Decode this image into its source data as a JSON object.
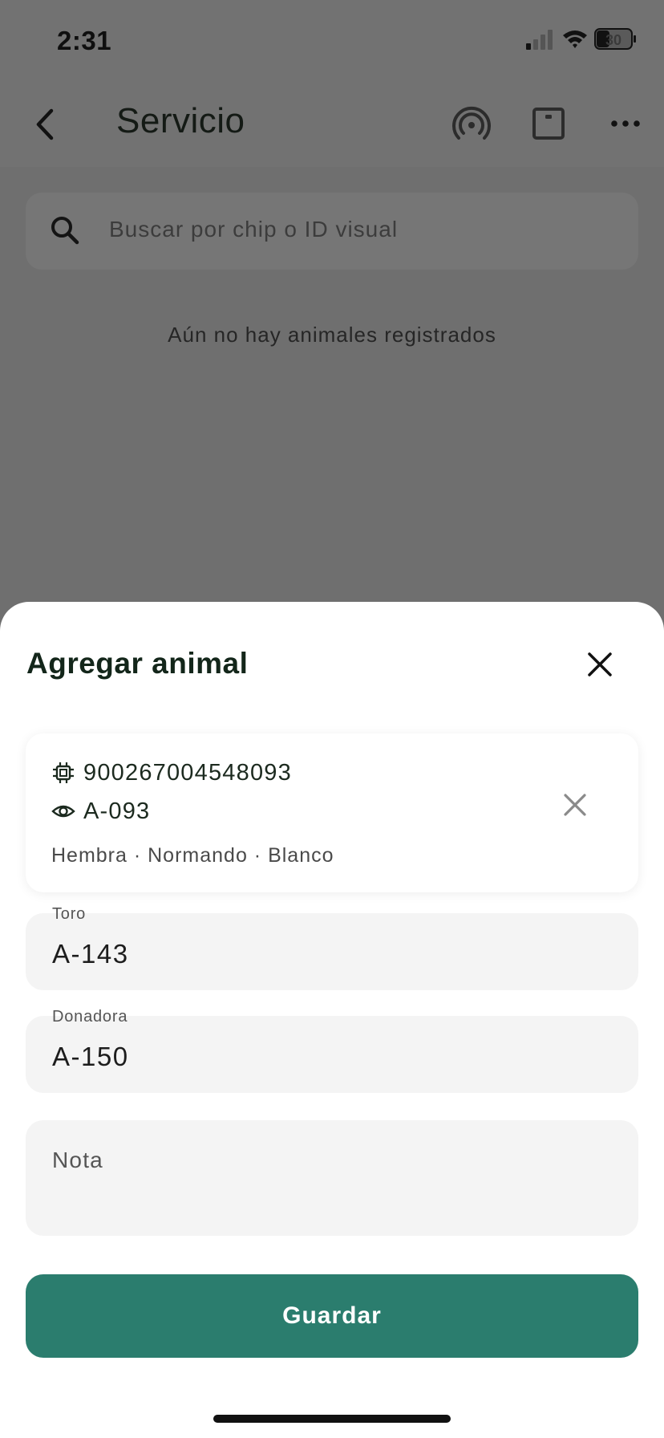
{
  "status": {
    "time": "2:31",
    "battery": "30"
  },
  "nav": {
    "title": "Servicio"
  },
  "search": {
    "placeholder": "Buscar por chip o ID visual"
  },
  "main": {
    "empty_message": "Aún no hay animales registrados"
  },
  "sheet": {
    "title": "Agregar animal",
    "animal": {
      "chip": "900267004548093",
      "visual_id": "A-093",
      "details": "Hembra · Normando · Blanco"
    },
    "toro": {
      "label": "Toro",
      "value": "A-143"
    },
    "donadora": {
      "label": "Donadora",
      "value": "A-150"
    },
    "note": {
      "placeholder": "Nota"
    },
    "save_label": "Guardar"
  },
  "colors": {
    "accent": "#2b7d6e",
    "overlay": "#6f6f6f"
  },
  "icons": [
    "back-icon",
    "rfid-icon",
    "scale-icon",
    "more-icon",
    "search-icon",
    "close-icon",
    "chip-icon",
    "eye-icon"
  ]
}
